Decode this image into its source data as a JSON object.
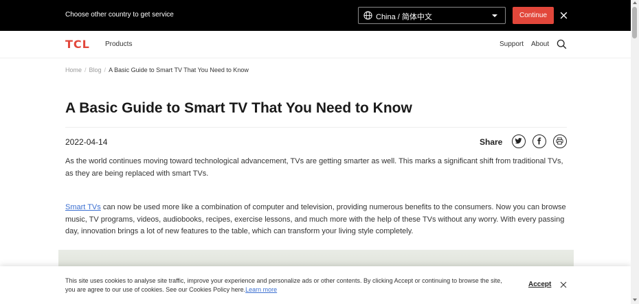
{
  "country_bar": {
    "message": "Choose other country to get service",
    "selected_country": "China / 简体中文",
    "continue_label": "Continue"
  },
  "header": {
    "logo": "TCL",
    "nav": {
      "products": "Products",
      "support": "Support",
      "about": "About"
    }
  },
  "breadcrumb": {
    "items": [
      "Home",
      "Blog",
      "A Basic Guide to Smart TV That You Need to Know"
    ],
    "separator": "/"
  },
  "article": {
    "title": "A Basic Guide to Smart TV That You Need to Know",
    "date": "2022-04-14",
    "share_label": "Share",
    "share_icons": [
      "twitter-icon",
      "facebook-icon",
      "print-icon"
    ],
    "para1": "As the world continues moving toward technological advancement, TVs are getting smarter as well. This marks a significant shift from traditional TVs, as they are being replaced with smart TVs.",
    "para2_link": "Smart TVs",
    "para2_rest": " can now be used more like a combination of computer and television, providing numerous benefits to the consumers. Now you can browse music, TV programs, videos, audiobooks, recipes, exercise lessons, and much more with the help of these TVs without any worry. With every passing day, innovation brings a lot of new features to the table, which can transform your living style completely."
  },
  "cookie": {
    "text": "This site uses cookies to analyse site traffic, improve your experience and personalize ads or other contents. By clicking Accept or continuing to browse the site, you are agree to our use of cookies. See our Cookies Policy here.",
    "learn_more": "Learn more",
    "accept": "Accept"
  },
  "colors": {
    "brand": "#e2473b",
    "link": "#3b6fd1",
    "bar_bg": "#000000"
  }
}
